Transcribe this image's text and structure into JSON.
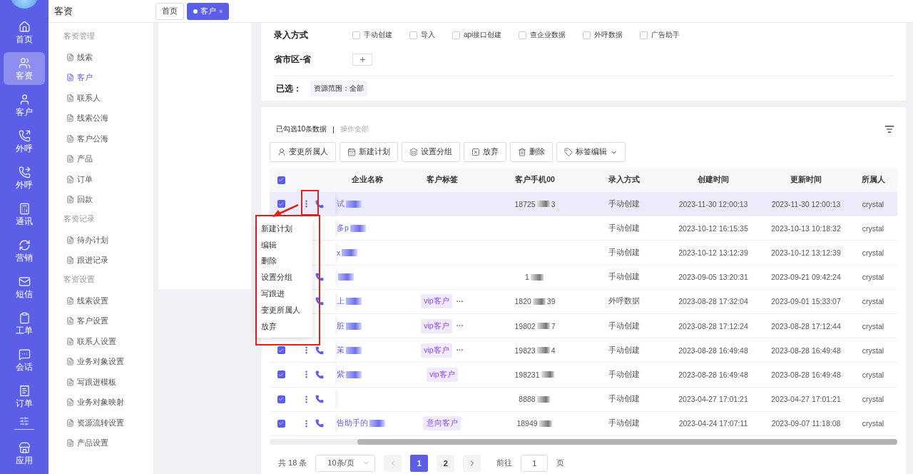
{
  "nav": {
    "items": [
      {
        "label": "首页",
        "selected": false
      },
      {
        "label": "客资",
        "selected": true
      },
      {
        "label": "客户",
        "selected": false
      },
      {
        "label": "外呼",
        "selected": false
      },
      {
        "label": "外呼",
        "selected": false
      },
      {
        "label": "通讯",
        "selected": false
      },
      {
        "label": "营销",
        "selected": false
      },
      {
        "label": "短信",
        "selected": false
      },
      {
        "label": "工单",
        "selected": false
      },
      {
        "label": "会话",
        "selected": false
      },
      {
        "label": "订单",
        "selected": false
      }
    ],
    "bottom": {
      "label": "应用"
    }
  },
  "section_title": "客资",
  "tabs": [
    {
      "label": "首页",
      "selected": false,
      "closable": false
    },
    {
      "label": "客户",
      "selected": true,
      "closable": true,
      "close": "×"
    }
  ],
  "submenu": [
    {
      "title": "客资管理",
      "items": [
        {
          "label": "线索",
          "selected": false
        },
        {
          "label": "客户",
          "selected": true
        },
        {
          "label": "联系人",
          "selected": false
        },
        {
          "label": "线索公海",
          "selected": false
        },
        {
          "label": "客户公海",
          "selected": false
        },
        {
          "label": "产品",
          "selected": false
        },
        {
          "label": "订单",
          "selected": false
        },
        {
          "label": "回款",
          "selected": false
        }
      ]
    },
    {
      "title": "客资记录",
      "items": [
        {
          "label": "待办计划",
          "selected": false
        },
        {
          "label": "跟进记录",
          "selected": false
        }
      ]
    },
    {
      "title": "客资设置",
      "items": [
        {
          "label": "线索设置",
          "selected": false
        },
        {
          "label": "客户设置",
          "selected": false
        },
        {
          "label": "联系人设置",
          "selected": false
        },
        {
          "label": "业务对象设置",
          "selected": false
        },
        {
          "label": "写跟进模板",
          "selected": false
        },
        {
          "label": "业务对象映射",
          "selected": false
        },
        {
          "label": "资源流转设置",
          "selected": false
        },
        {
          "label": "产品设置",
          "selected": false
        }
      ]
    }
  ],
  "filters": {
    "entry_method": {
      "label": "录入方式",
      "options": [
        {
          "label": "手动创建",
          "checked": false
        },
        {
          "label": "导入",
          "checked": false
        },
        {
          "label": "api接口创建",
          "checked": false
        },
        {
          "label": "查企业数据",
          "checked": false
        },
        {
          "label": "外呼数据",
          "checked": false
        },
        {
          "label": "广告助手",
          "checked": false
        }
      ]
    },
    "region": {
      "label": "省市区-省"
    },
    "selected": {
      "label": "已选：",
      "chips": [
        "资源范围：全部"
      ]
    }
  },
  "table": {
    "selection_info": "已勾选10条数据",
    "separator": "|",
    "operate_all": "操作全部",
    "actions": [
      {
        "label": "变更所属人"
      },
      {
        "label": "新建计划"
      },
      {
        "label": "设置分组"
      },
      {
        "label": "放弃"
      },
      {
        "label": "删除"
      },
      {
        "label": "标签编辑",
        "dropdown": true
      }
    ],
    "header_checked": true,
    "columns": [
      "企业名称",
      "客户标签",
      "客户手机00",
      "录入方式",
      "创建时间",
      "更新时间",
      "所属人"
    ],
    "rows": [
      {
        "selected": true,
        "checked": true,
        "more": true,
        "phone_icon": true,
        "name": "试",
        "name_blurred": true,
        "tags": [],
        "phone": "18725",
        "phone_tail": "3",
        "method": "手动创建",
        "created": "2023-11-30 12:00:13",
        "updated": "2023-11-30 12:00:13",
        "owner": "crystal"
      },
      {
        "selected": false,
        "name": "多p",
        "name_blurred": true,
        "tags": [],
        "method": "手动创建",
        "created": "2023-10-12 16:15:35",
        "updated": "2023-10-13 10:18:32",
        "owner": "crystal"
      },
      {
        "selected": false,
        "name": "x",
        "name_blurred": true,
        "tags": [],
        "method": "手动创建",
        "created": "2023-10-12 13:12:39",
        "updated": "2023-10-12 13:12:39",
        "owner": "crystal"
      },
      {
        "selected": false,
        "phone_icon": true,
        "name_blurred": true,
        "tags": [],
        "phone": "1",
        "method": "手动创建",
        "created": "2023-09-05 13:20:31",
        "updated": "2023-09-21 09:42:24",
        "owner": "crystal"
      },
      {
        "selected": false,
        "phone_icon": true,
        "name": "上",
        "name_blurred": true,
        "tags": [
          "vip客户"
        ],
        "tags_more": "···",
        "phone": "1820",
        "phone_tail": "39",
        "method": "外呼数据",
        "created": "2023-08-28 17:32:04",
        "updated": "2023-09-01 15:33:07",
        "owner": "crystal"
      },
      {
        "selected": false,
        "name": "脏",
        "name_blurred": true,
        "tags": [
          "vip客户"
        ],
        "tags_more": "···",
        "phone": "19802",
        "phone_tail": "7",
        "method": "手动创建",
        "created": "2023-08-28 17:12:24",
        "updated": "2023-08-28 17:12:44",
        "owner": "crystal"
      },
      {
        "selected": false,
        "checked": true,
        "more": true,
        "phone_icon": true,
        "name": "茉",
        "name_blurred": true,
        "tags": [
          "vip客户"
        ],
        "tags_more": "···",
        "phone": "19823",
        "phone_tail": "4",
        "method": "手动创建",
        "created": "2023-08-28 16:49:48",
        "updated": "2023-08-28 16:49:48",
        "owner": "crystal"
      },
      {
        "selected": false,
        "checked": true,
        "more": true,
        "phone_icon": true,
        "name": "紫",
        "name_blurred": true,
        "tags": [
          "vip客户"
        ],
        "phone": "198231",
        "method": "手动创建",
        "created": "2023-08-28 16:49:48",
        "updated": "2023-08-28 16:49:48",
        "owner": "crystal"
      },
      {
        "selected": false,
        "checked": true,
        "more": true,
        "phone_icon": true,
        "tags": [],
        "phone": "8888",
        "method": "手动创建",
        "created": "2023-04-27 17:01:21",
        "updated": "2023-04-27 17:01:21",
        "owner": "crystal"
      },
      {
        "selected": false,
        "checked": true,
        "more": true,
        "phone_icon": true,
        "name": "告助手的",
        "name_blurred": true,
        "tags": [
          "意向客户"
        ],
        "phone": "18949",
        "method": "手动创建",
        "created": "2023-04-24 17:07:11",
        "updated": "2023-09-07 11:18:08",
        "owner": "crystal"
      }
    ]
  },
  "row_menu": {
    "items": [
      "新建计划",
      "编辑",
      "删除",
      "设置分组",
      "写跟进",
      "变更所属人",
      "放弃"
    ]
  },
  "pagination": {
    "total": "共 18 条",
    "page_size": "10条/页",
    "pages": [
      {
        "label": "1",
        "selected": true
      },
      {
        "label": "2",
        "selected": false
      }
    ],
    "goto_label": "前往",
    "goto_value": "1",
    "goto_unit": "页"
  }
}
